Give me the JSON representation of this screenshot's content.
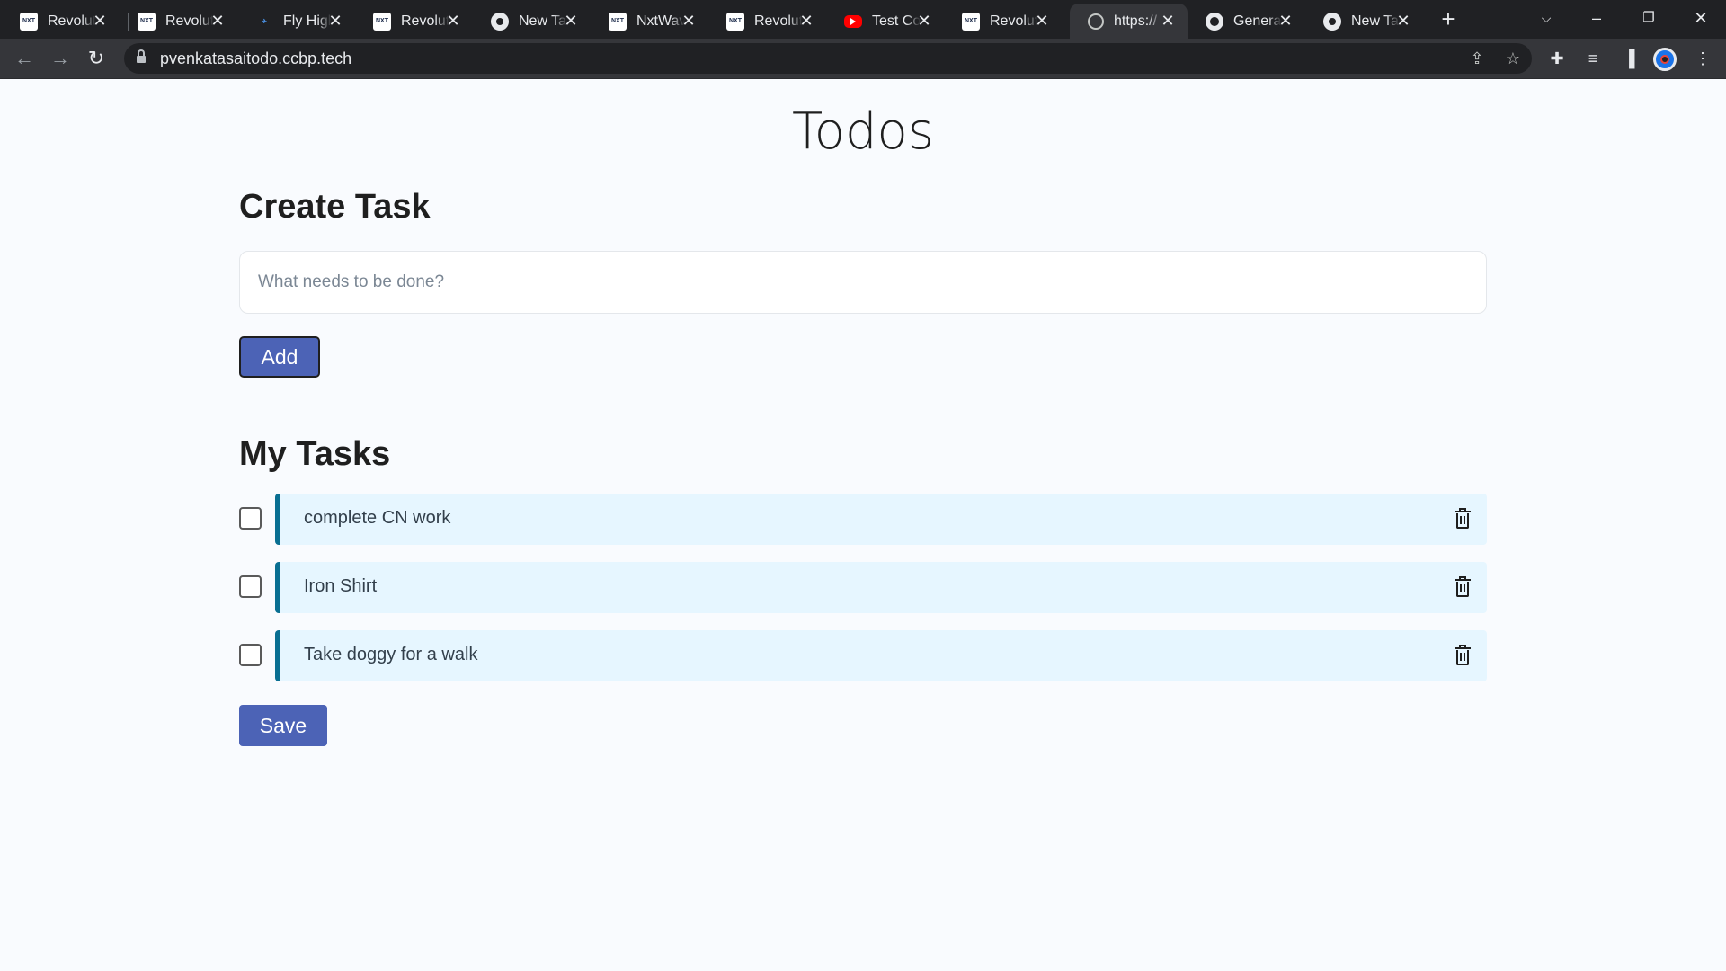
{
  "browser": {
    "tabs": [
      {
        "title": "Revolut",
        "icon": "nxtwave-icon"
      },
      {
        "title": "Revolut",
        "icon": "nxtwave-icon"
      },
      {
        "title": "Fly High",
        "icon": "plane-icon"
      },
      {
        "title": "Revolut",
        "icon": "nxtwave-icon"
      },
      {
        "title": "New Tab",
        "icon": "chrome-icon"
      },
      {
        "title": "NxtWave",
        "icon": "nxtwave-icon"
      },
      {
        "title": "Revolut",
        "icon": "nxtwave-icon"
      },
      {
        "title": "Test Co",
        "icon": "youtube-icon"
      },
      {
        "title": "Revolut",
        "icon": "nxtwave-icon"
      },
      {
        "title": "https://",
        "icon": "globe-icon",
        "active": true
      },
      {
        "title": "General",
        "icon": "github-icon"
      },
      {
        "title": "New Tab",
        "icon": "chrome-icon"
      }
    ],
    "url": "pvenkatasaitodo.ccbp.tech"
  },
  "page": {
    "title": "Todos",
    "create_section": {
      "bold": "Create",
      "rest": " Task"
    },
    "input": {
      "placeholder": "What needs to be done?",
      "value": ""
    },
    "add_label": "Add",
    "tasks_section": {
      "bold": "My",
      "rest": " Tasks"
    },
    "todos": [
      {
        "label": "complete CN work",
        "checked": false
      },
      {
        "label": "Iron Shirt",
        "checked": false
      },
      {
        "label": "Take doggy for a walk",
        "checked": false
      }
    ],
    "save_label": "Save"
  },
  "colors": {
    "button": "#4c63b6",
    "todo_card": "#e6f6ff",
    "todo_border": "#096f92",
    "page_bg": "#f9fbfe"
  }
}
